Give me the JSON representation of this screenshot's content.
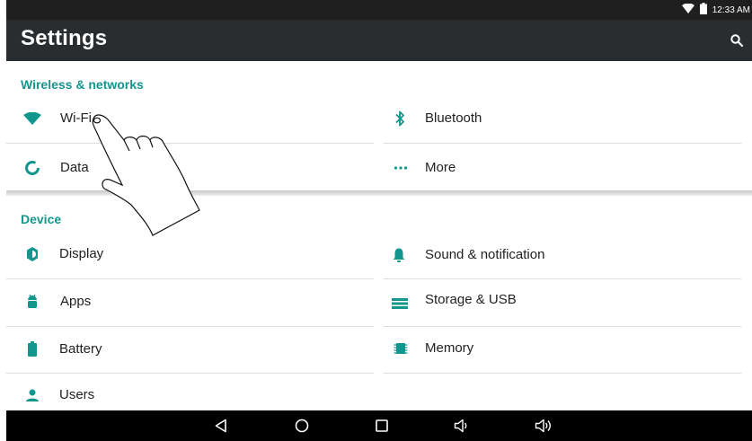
{
  "status_bar": {
    "time": "12:33 AM",
    "icons": [
      "wifi-icon",
      "battery-icon"
    ]
  },
  "app_bar": {
    "title": "Settings",
    "search_icon": "search-icon"
  },
  "sections": [
    {
      "title": "Wireless & networks",
      "items": [
        {
          "label": "Wi-Fi",
          "icon": "wifi-icon"
        },
        {
          "label": "Bluetooth",
          "icon": "bluetooth-icon"
        },
        {
          "label": "Data",
          "icon": "data-usage-icon"
        },
        {
          "label": "More",
          "icon": "more-icon"
        }
      ]
    },
    {
      "title": "Device",
      "items": [
        {
          "label": "Display",
          "icon": "display-icon"
        },
        {
          "label": "Sound & notification",
          "icon": "bell-icon"
        },
        {
          "label": "Apps",
          "icon": "android-icon"
        },
        {
          "label": "Storage & USB",
          "icon": "storage-icon"
        },
        {
          "label": "Battery",
          "icon": "battery-icon"
        },
        {
          "label": "Memory",
          "icon": "memory-icon"
        },
        {
          "label": "Users",
          "icon": "user-icon"
        }
      ]
    }
  ],
  "nav_bar": [
    "back-icon",
    "home-icon",
    "recents-icon",
    "volume-down-icon",
    "volume-up-icon"
  ],
  "colors": {
    "accent": "#13968e",
    "app_bar": "#2a2d30",
    "status_bar": "#1f1f1f",
    "nav_bar": "#000000"
  }
}
